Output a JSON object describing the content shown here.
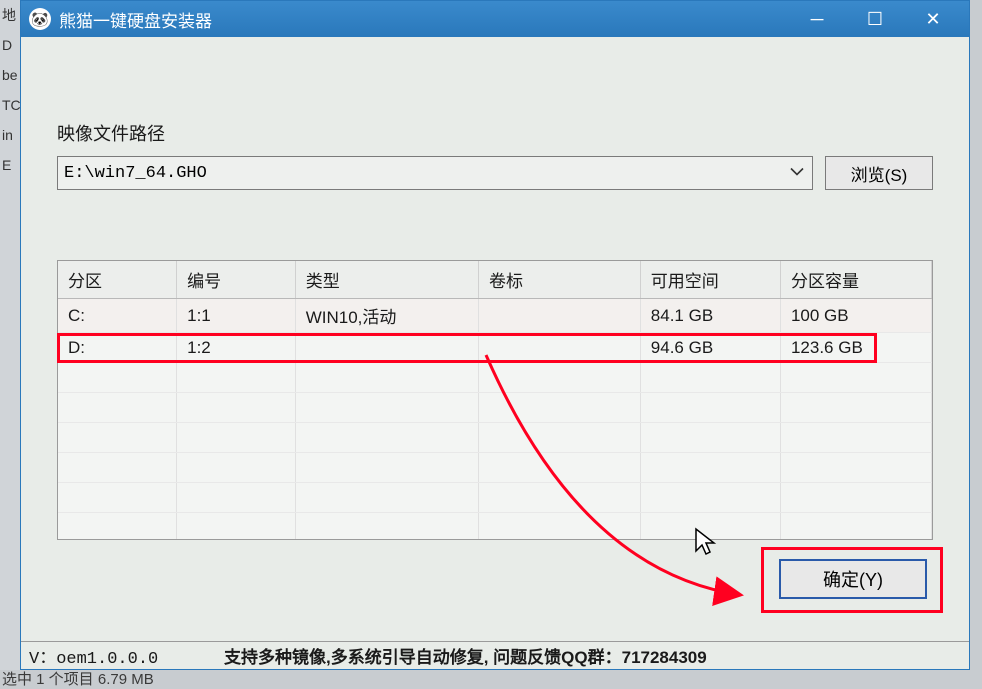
{
  "window": {
    "title": "熊猫一键硬盘安装器",
    "icon": "🐼"
  },
  "image_path": {
    "label": "映像文件路径",
    "value": "E:\\win7_64.GHO",
    "browse_label": "浏览(S)"
  },
  "table": {
    "headers": {
      "partition": "分区",
      "number": "编号",
      "type": "类型",
      "label": "卷标",
      "free": "可用空间",
      "capacity": "分区容量"
    },
    "rows": [
      {
        "partition": "C:",
        "number": "1:1",
        "type": "WIN10,活动",
        "label": "",
        "free": "84.1 GB",
        "capacity": "100 GB"
      },
      {
        "partition": "D:",
        "number": "1:2",
        "type": "",
        "label": "",
        "free": "94.6 GB",
        "capacity": "123.6 GB"
      }
    ]
  },
  "buttons": {
    "ok": "确定(Y)"
  },
  "status": {
    "version": "V：oem1.0.0.0",
    "message": "支持多种镜像,多系统引导自动修复, 问题反馈QQ群：717284309"
  },
  "behind": {
    "bottom": "选中 1 个项目   6.79 MB"
  }
}
